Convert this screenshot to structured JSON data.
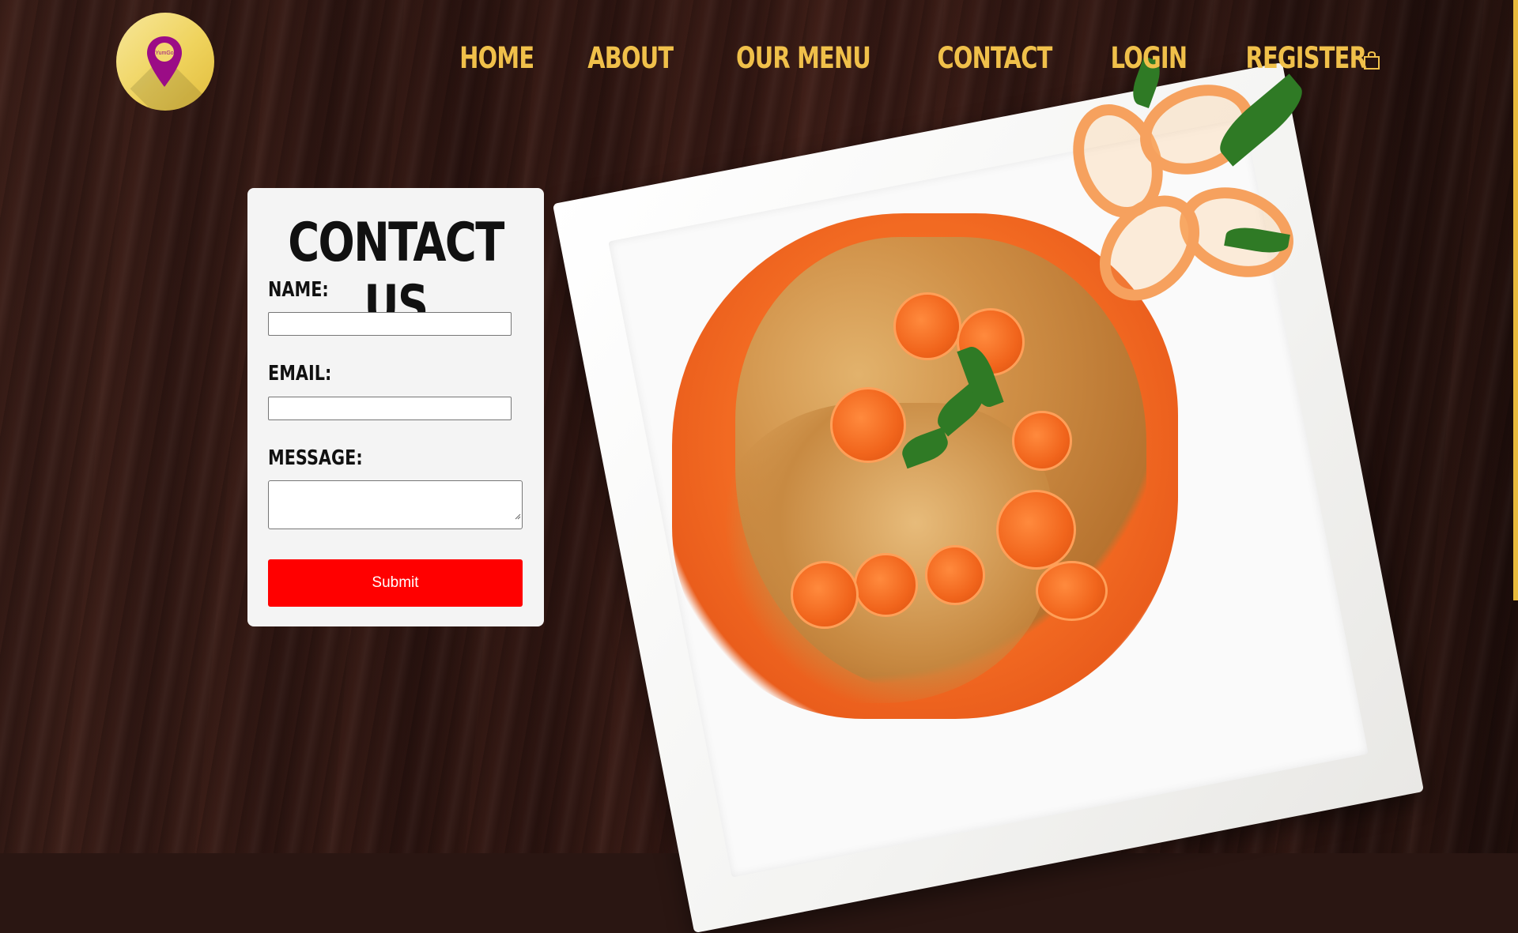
{
  "logo": {
    "text": "YumGo",
    "alt": "YumGo location pin logo"
  },
  "nav": {
    "items": [
      {
        "label": "HOME"
      },
      {
        "label": "ABOUT"
      },
      {
        "label": "OUR MENU"
      },
      {
        "label": "CONTACT"
      },
      {
        "label": "LOGIN"
      },
      {
        "label": "REGISTER"
      }
    ],
    "cart_icon": "shopping-bag-icon"
  },
  "contact": {
    "title": "CONTACT US",
    "name_label": "NAME:",
    "name_value": "",
    "email_label": "EMAIL:",
    "email_value": "",
    "message_label": "MESSAGE:",
    "message_value": "",
    "submit_label": "Submit"
  },
  "colors": {
    "accent": "#f0c04a",
    "submit": "#ff0000",
    "card_bg": "#f4f4f4"
  }
}
